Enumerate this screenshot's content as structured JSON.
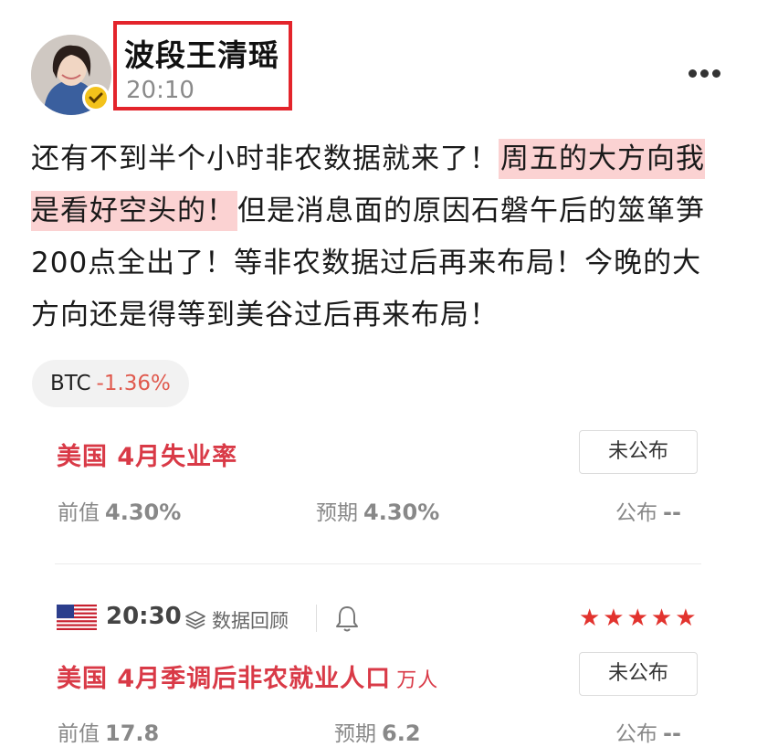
{
  "post": {
    "author": "波段王清瑶",
    "time": "20:10",
    "body_part1": "还有不到半个小时非农数据就来了！",
    "body_highlight": "周五的大方向我是看好空头的！",
    "body_part2": "但是消息面的原因石磐午后的筮箪笋200点全出了！等非农数据过后再来布局！今晚的大方向还是得等到美谷过后再来布局！"
  },
  "ticker": {
    "symbol": "BTC",
    "change": "-1.36%"
  },
  "events": [
    {
      "title": "美国 4月失业率",
      "unit": "",
      "status": "未公布",
      "previous_label": "前值",
      "previous_value": "4.30%",
      "forecast_label": "预期",
      "forecast_value": "4.30%",
      "actual_label": "公布",
      "actual_value": "--"
    },
    {
      "time": "20:30",
      "review_label": "数据回顾",
      "stars": "★★★★★",
      "importance": 5,
      "title": "美国 4月季调后非农就业人口",
      "unit": "万人",
      "status": "未公布",
      "previous_label": "前值",
      "previous_value": "17.8",
      "forecast_label": "预期",
      "forecast_value": "6.2",
      "actual_label": "公布",
      "actual_value": "--"
    }
  ],
  "colors": {
    "highlight_bg": "#fbd2d2",
    "event_red": "#d93a47",
    "negative_change": "#e05a4e",
    "annotation_box": "#e3242b",
    "verified_badge": "#f3c21b"
  },
  "icons": [
    "more-icon",
    "verified-icon",
    "layers-icon",
    "bell-icon",
    "us-flag-icon",
    "star-icon"
  ]
}
